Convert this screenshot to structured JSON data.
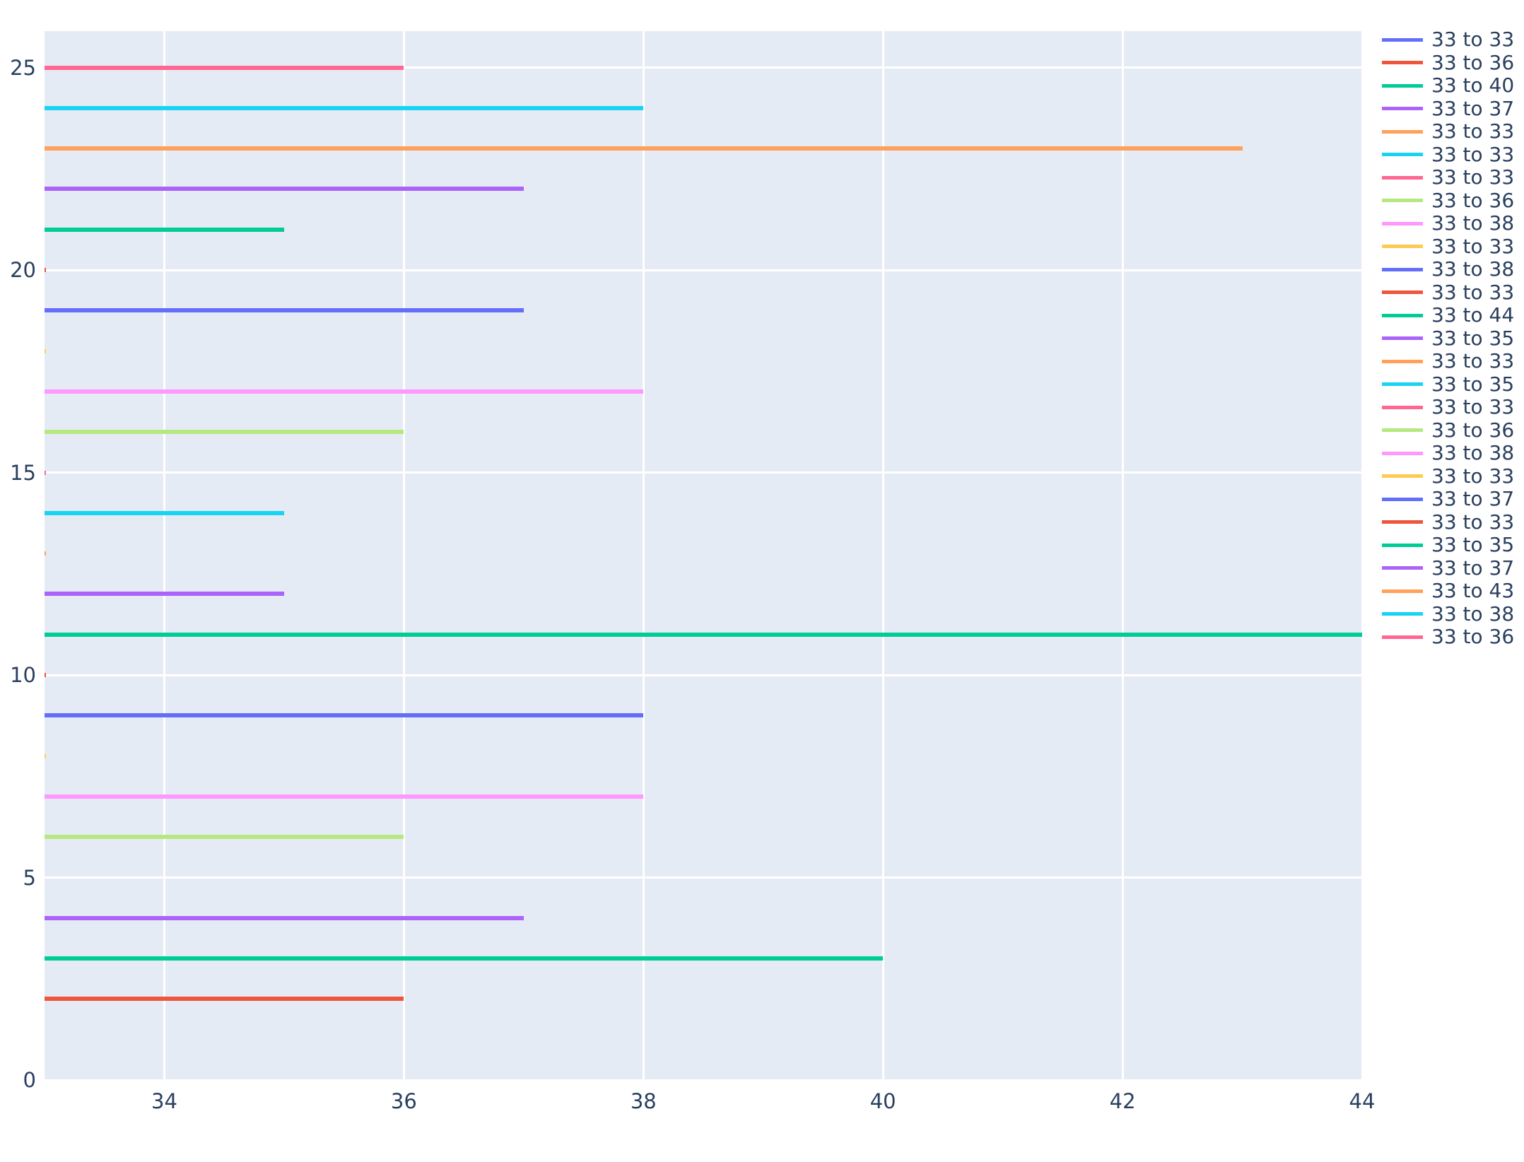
{
  "chart_data": {
    "type": "line",
    "title": "",
    "subtitle": "",
    "xlabel": "",
    "ylabel": "",
    "xlim": [
      33,
      44
    ],
    "ylim": [
      0,
      25.9
    ],
    "x_ticks": [
      34,
      36,
      38,
      40,
      42,
      44
    ],
    "y_ticks": [
      0,
      5,
      10,
      15,
      20,
      25
    ],
    "grid": true,
    "legend_position": "right",
    "plot_bg": "#e5ebf5",
    "paper_bg": "#ffffff",
    "grid_color": "#ffffff",
    "tick_color": "#2a3f5f",
    "note": "Each series is a horizontal segment drawn at a constant y level, spanning from x=33 to the end value named in its legend label.",
    "series": [
      {
        "name": "33 to 33",
        "color": "#636efa",
        "x_start": 33,
        "x_end": 33,
        "y": 19
      },
      {
        "name": "33 to 36",
        "color": "#ef553b",
        "x_start": 33,
        "x_end": 36,
        "y": 2
      },
      {
        "name": "33 to 40",
        "color": "#00cc96",
        "x_start": 33,
        "x_end": 40,
        "y": 3
      },
      {
        "name": "33 to 37",
        "color": "#ab63fa",
        "x_start": 33,
        "x_end": 37,
        "y": 4
      },
      {
        "name": "33 to 33",
        "color": "#ffa15a",
        "x_start": 33,
        "x_end": 33,
        "y": 23
      },
      {
        "name": "33 to 33",
        "color": "#19d3f3",
        "x_start": 33,
        "x_end": 33,
        "y": 24
      },
      {
        "name": "33 to 33",
        "color": "#ff6692",
        "x_start": 33,
        "x_end": 33,
        "y": 25
      },
      {
        "name": "33 to 36",
        "color": "#b6e880",
        "x_start": 33,
        "x_end": 36,
        "y": 16
      },
      {
        "name": "33 to 38",
        "color": "#ff97ff",
        "x_start": 33,
        "x_end": 38,
        "y": 17
      },
      {
        "name": "33 to 33",
        "color": "#fecb52",
        "x_start": 33,
        "x_end": 33,
        "y": 18
      },
      {
        "name": "33 to 38",
        "color": "#636efa",
        "x_start": 33,
        "x_end": 38,
        "y": 9
      },
      {
        "name": "33 to 33",
        "color": "#ef553b",
        "x_start": 33,
        "x_end": 33,
        "y": 10
      },
      {
        "name": "33 to 44",
        "color": "#00cc96",
        "x_start": 33,
        "x_end": 44,
        "y": 11
      },
      {
        "name": "33 to 35",
        "color": "#ab63fa",
        "x_start": 33,
        "x_end": 35,
        "y": 12
      },
      {
        "name": "33 to 33",
        "color": "#ffa15a",
        "x_start": 33,
        "x_end": 33,
        "y": 13
      },
      {
        "name": "33 to 35",
        "color": "#19d3f3",
        "x_start": 33,
        "x_end": 35,
        "y": 14
      },
      {
        "name": "33 to 33",
        "color": "#ff6692",
        "x_start": 33,
        "x_end": 33,
        "y": 15
      },
      {
        "name": "33 to 36",
        "color": "#b6e880",
        "x_start": 33,
        "x_end": 36,
        "y": 6
      },
      {
        "name": "33 to 38",
        "color": "#ff97ff",
        "x_start": 33,
        "x_end": 38,
        "y": 7
      },
      {
        "name": "33 to 33",
        "color": "#fecb52",
        "x_start": 33,
        "x_end": 33,
        "y": 8
      },
      {
        "name": "33 to 37",
        "color": "#636efa",
        "x_start": 33,
        "x_end": 37,
        "y": 19
      },
      {
        "name": "33 to 33",
        "color": "#ef553b",
        "x_start": 33,
        "x_end": 33,
        "y": 20
      },
      {
        "name": "33 to 35",
        "color": "#00cc96",
        "x_start": 33,
        "x_end": 35,
        "y": 21
      },
      {
        "name": "33 to 37",
        "color": "#ab63fa",
        "x_start": 33,
        "x_end": 37,
        "y": 22
      },
      {
        "name": "33 to 43",
        "color": "#ffa15a",
        "x_start": 33,
        "x_end": 43,
        "y": 23
      },
      {
        "name": "33 to 38",
        "color": "#19d3f3",
        "x_start": 33,
        "x_end": 38,
        "y": 24
      },
      {
        "name": "33 to 36",
        "color": "#ff6692",
        "x_start": 33,
        "x_end": 36,
        "y": 25
      }
    ]
  }
}
